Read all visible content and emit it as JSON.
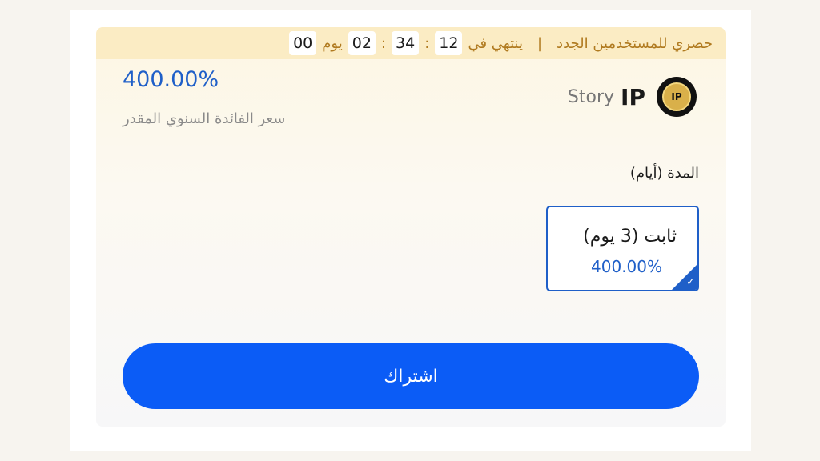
{
  "promo": {
    "text": "حصري للمستخدمين الجدد",
    "divider": "|",
    "ends_in": "ينتهي في",
    "days": "00",
    "days_label": "يوم",
    "hours": "02",
    "minutes": "34",
    "seconds": "12",
    "colon": ":"
  },
  "product": {
    "apr": "400.00%",
    "apr_label": "سعر الفائدة السنوي المقدر",
    "token_symbol": "IP",
    "token_name": "Story",
    "logo_text": "IP"
  },
  "duration": {
    "label": "المدة (أيام)",
    "options": [
      {
        "title": "ثابت (3 يوم)",
        "rate": "400.00%",
        "selected": true
      }
    ]
  },
  "actions": {
    "subscribe_label": "اشتراك"
  },
  "icons": {
    "selected_check": "check-icon"
  },
  "colors": {
    "accent": "#1f5fc8",
    "button": "#0b5cf6",
    "promo_bg": "#fbecc4",
    "promo_text": "#b07a1f"
  }
}
